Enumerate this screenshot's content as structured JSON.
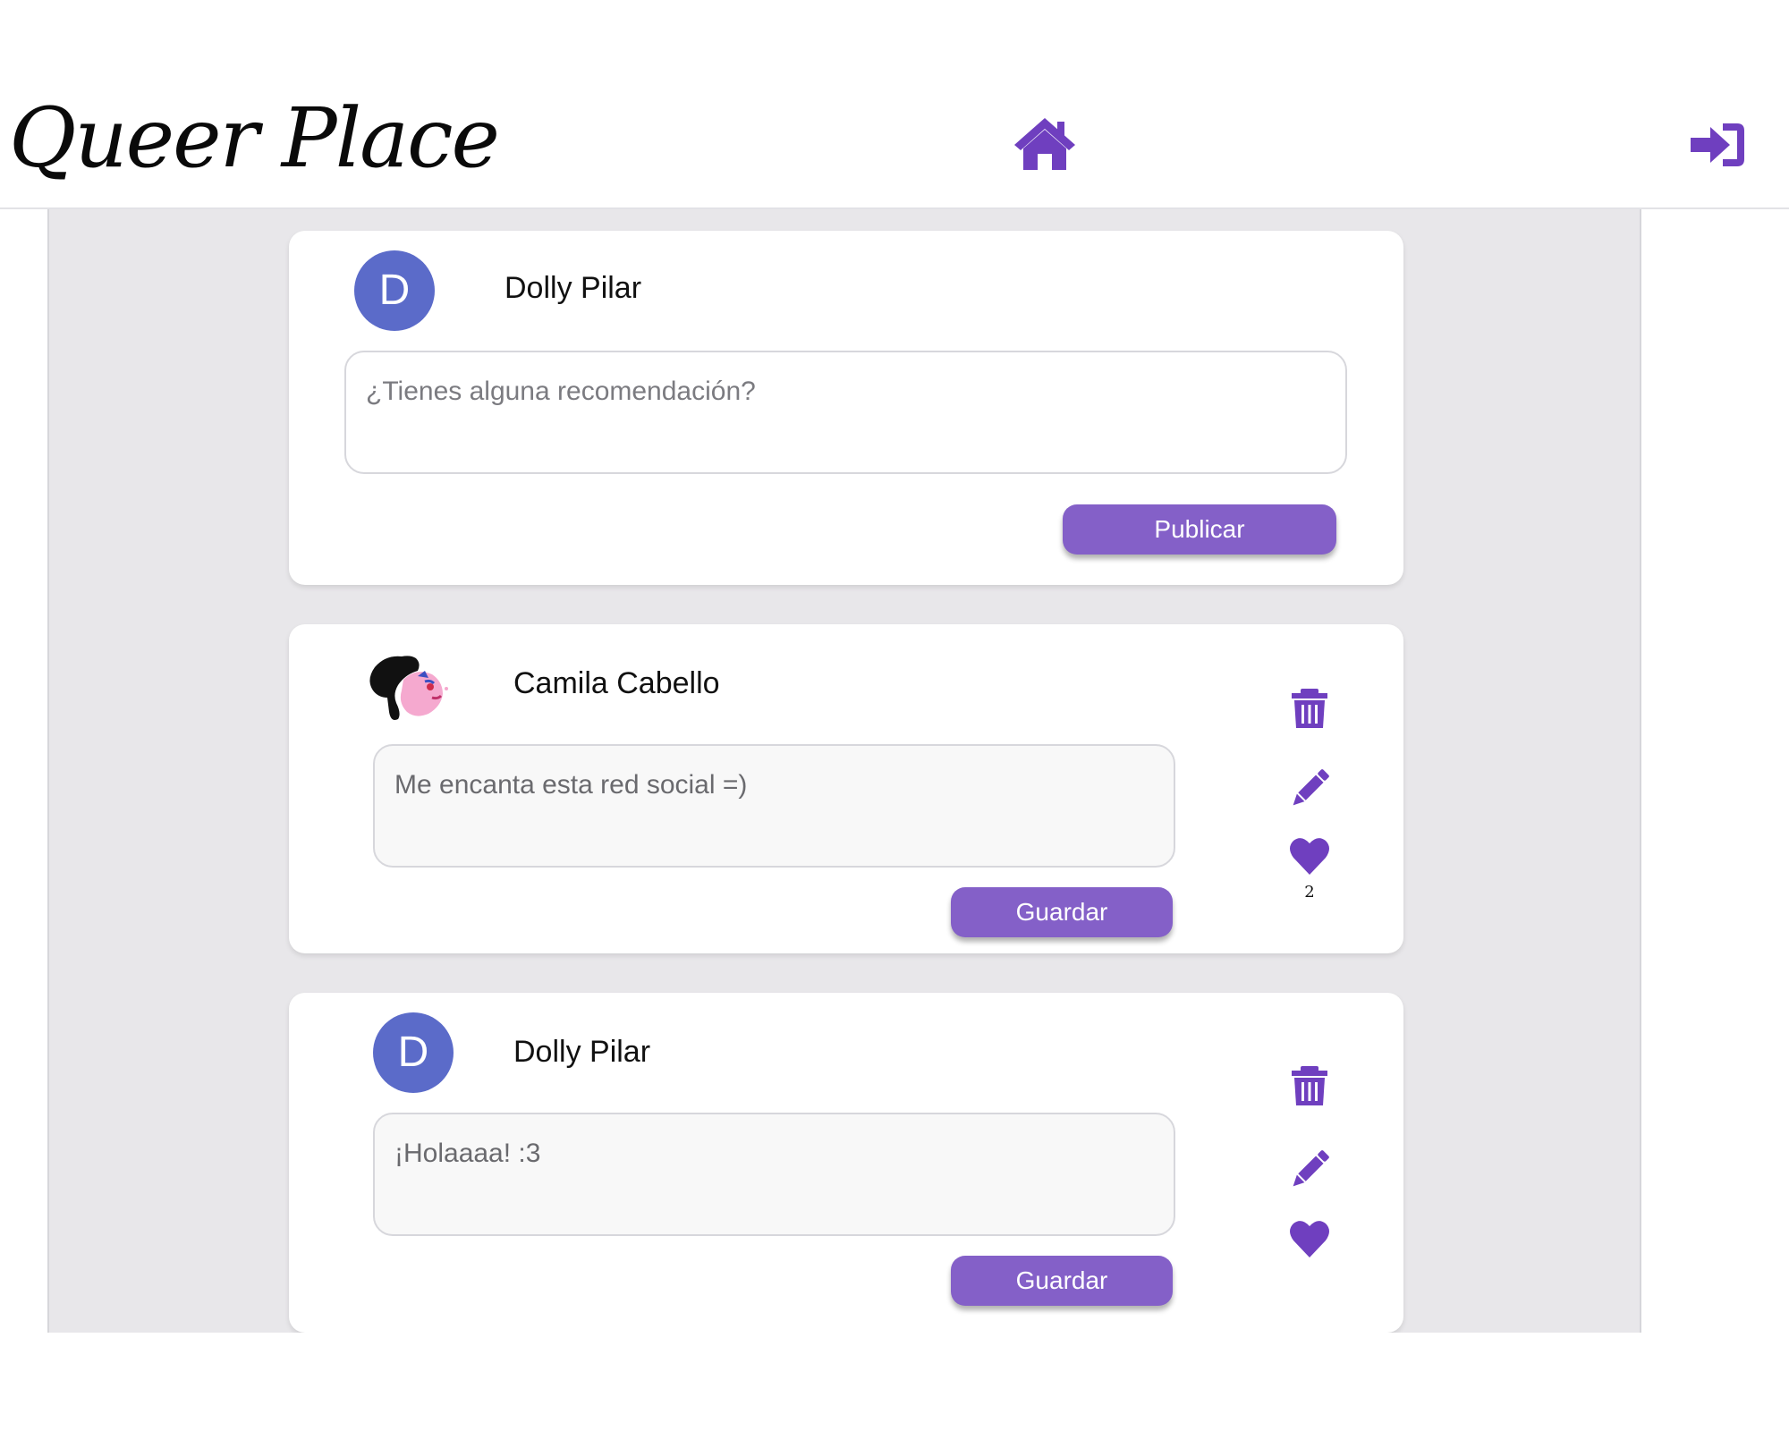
{
  "app": {
    "logo_text": "Queer Place"
  },
  "header": {
    "home_icon": "home-icon",
    "login_icon": "sign-in-icon"
  },
  "colors": {
    "accent": "#8460c8",
    "icon_purple": "#6f3fbf",
    "avatar_blue": "#5b6bc9",
    "feed_background": "#e8e7ea"
  },
  "composer": {
    "avatar_letter": "D",
    "username": "Dolly Pilar",
    "placeholder": "¿Tienes alguna recomendación?",
    "publish_label": "Publicar"
  },
  "posts": [
    {
      "avatar_type": "illustration",
      "username": "Camila Cabello",
      "text": "Me encanta esta red social =)",
      "save_label": "Guardar",
      "like_count": "2",
      "icons": [
        "trash-icon",
        "pencil-icon",
        "heart-icon"
      ]
    },
    {
      "avatar_type": "letter",
      "avatar_letter": "D",
      "username": "Dolly Pilar",
      "text": "¡Holaaaa! :3",
      "save_label": "Guardar",
      "icons": [
        "trash-icon",
        "pencil-icon",
        "heart-icon"
      ]
    }
  ]
}
